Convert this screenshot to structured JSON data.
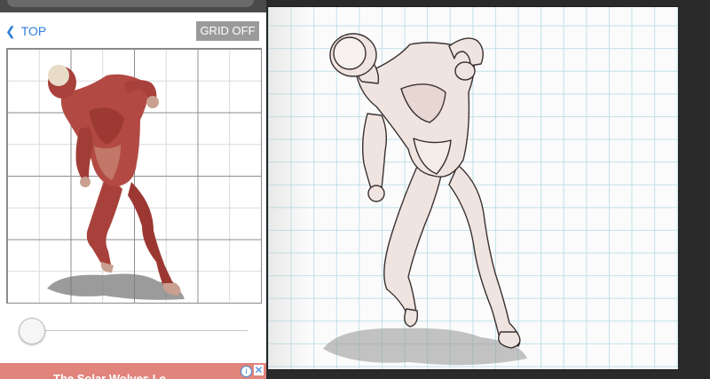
{
  "reference_panel": {
    "back_label": "TOP",
    "grid_toggle_label": "GRID OFF",
    "slider_value": 0,
    "ad_banner": {
      "text": "The Solar Wolves Le",
      "info_glyph": "i",
      "close_glyph": "✕"
    }
  },
  "colors": {
    "link": "#2f7ed8",
    "grid_toggle_bg": "#9a9a9a",
    "ad_bg": "#e0847c",
    "canvas_grid": "#bfe1e8",
    "muscle": "#a8413b",
    "sketch_line": "#3a3030"
  },
  "icons": {
    "back": "chevron-left-icon",
    "ad_info": "info-icon",
    "ad_close": "close-icon"
  }
}
